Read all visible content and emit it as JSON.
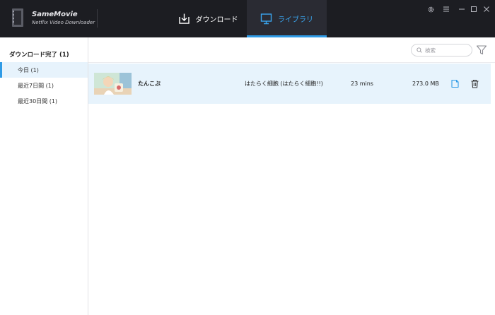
{
  "app": {
    "name": "SameMovie",
    "subtitle": "Netflix Video Downloader"
  },
  "tabs": {
    "download": {
      "label": "ダウンロード",
      "icon": "download-tray-icon"
    },
    "library": {
      "label": "ライブラリ",
      "icon": "monitor-icon"
    }
  },
  "window_controls": [
    "settings-gear-icon",
    "menu-icon",
    "minimize-icon",
    "maximize-icon",
    "close-icon"
  ],
  "sidebar": {
    "header": "ダウンロード完了 (1)",
    "items": [
      {
        "label": "今日 (1)",
        "active": true
      },
      {
        "label": "最近7日間 (1)",
        "active": false
      },
      {
        "label": "最近30日間 (1)",
        "active": false
      }
    ]
  },
  "search": {
    "placeholder": "検索"
  },
  "rows": [
    {
      "title": "たんこぶ",
      "series": "はたらく細胞 (はたらく細胞!!)",
      "duration": "23 mins",
      "size": "273.0 MB"
    }
  ],
  "colors": {
    "titlebar": "#1c1d22",
    "accent": "#2f9be6",
    "selected_row": "#e7f3fc"
  }
}
